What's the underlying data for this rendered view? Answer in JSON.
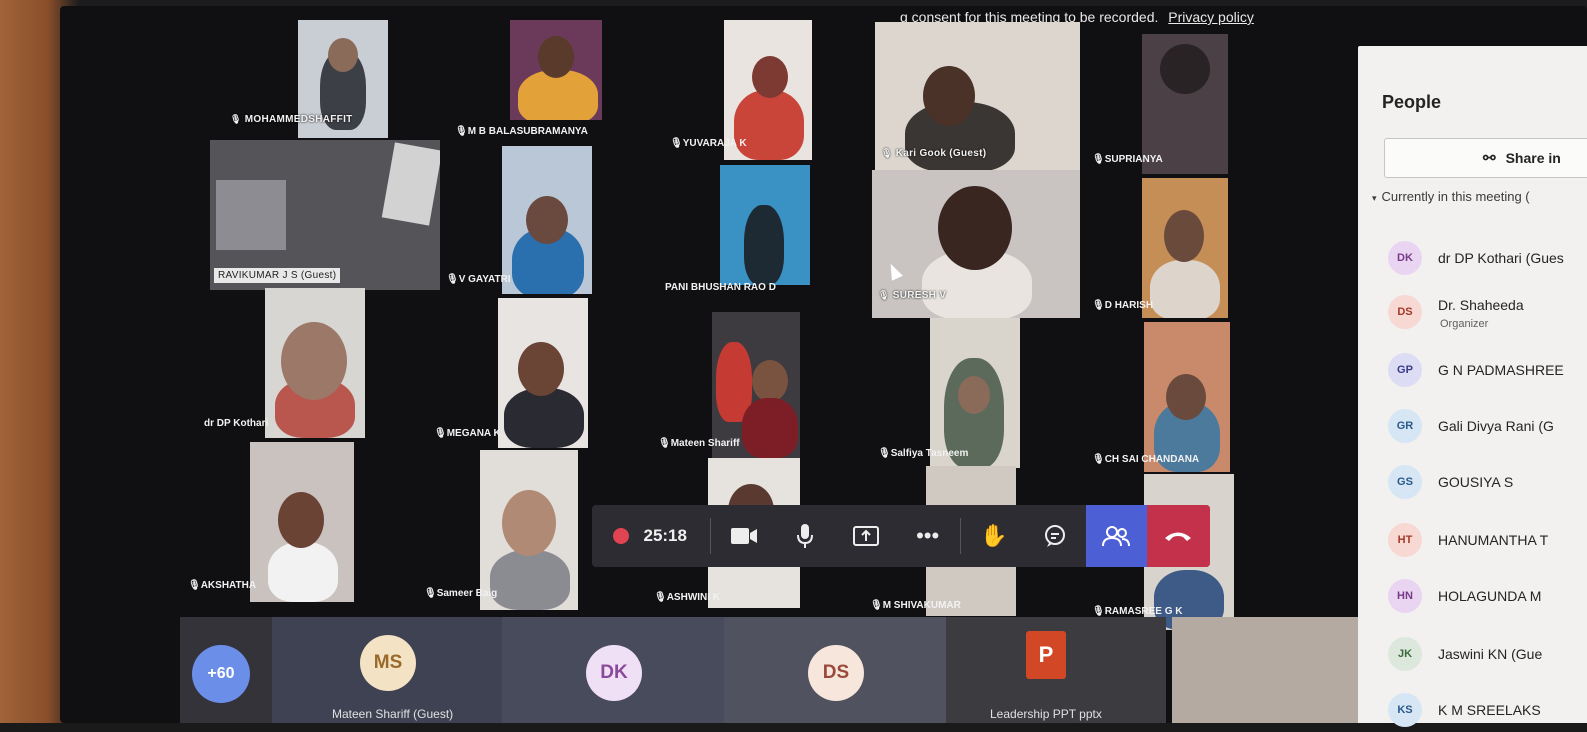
{
  "banner": {
    "text": "g consent for this meeting to be recorded.",
    "link": "Privacy policy"
  },
  "tiles": [
    {
      "name": "MOHAMMEDSHAFFIT"
    },
    {
      "name": "M B BALASUBRAMANYA"
    },
    {
      "name": "YUVARAJA K"
    },
    {
      "name": "Kari Gook (Guest)"
    },
    {
      "name": "SUPRIANYA"
    },
    {
      "name": "RAVIKUMAR J S (Guest)"
    },
    {
      "name": "V GAYATRI"
    },
    {
      "name": "PANI BHUSHAN RAO D"
    },
    {
      "name": "SURESH V"
    },
    {
      "name": "D HARISH"
    },
    {
      "name": "dr DP  Kothari"
    },
    {
      "name": "MEGANA K"
    },
    {
      "name": "Mateen Shariff"
    },
    {
      "name": "Salfiya Tasneem"
    },
    {
      "name": "CH SAI CHANDANA"
    },
    {
      "name": "AKSHATHA"
    },
    {
      "name": "Sameer Baig"
    },
    {
      "name": "ASHWINI K"
    },
    {
      "name": "M SHIVAKUMAR"
    },
    {
      "name": "RAMASREE G K"
    }
  ],
  "toolbar": {
    "timer": "25:18",
    "camera_icon": "camera-icon",
    "mic_icon": "microphone-icon",
    "share_icon": "share-screen-icon",
    "more_icon": "more-icon",
    "hand_icon": "raise-hand-icon",
    "chat_icon": "chat-icon",
    "people_icon": "people-icon",
    "leave_icon": "hang-up-icon",
    "leave_color": "#c4314b",
    "active_color": "#4c5fd4"
  },
  "bottom_row": {
    "more_count": "+60",
    "avatars": [
      {
        "initials": "MS",
        "caption": "Mateen Shariff (Guest)"
      },
      {
        "initials": "DK",
        "caption": ""
      },
      {
        "initials": "DS",
        "caption": ""
      }
    ],
    "file_caption": "Leadership PPT pptx"
  },
  "people_panel": {
    "title": "People",
    "share_label": "Share in",
    "section": "Currently in this meeting (",
    "participants": [
      {
        "initials": "DK",
        "name": "dr DP Kothari (Gues",
        "role": "",
        "color": "#e9d5f2"
      },
      {
        "initials": "DS",
        "name": "Dr. Shaheeda",
        "role": "Organizer",
        "color": "#f7d8d2"
      },
      {
        "initials": "GP",
        "name": "G N PADMASHREE",
        "role": "",
        "color": "#dcdcf5"
      },
      {
        "initials": "GR",
        "name": "Gali Divya Rani (G",
        "role": "",
        "color": "#d6e6f5"
      },
      {
        "initials": "GS",
        "name": "GOUSIYA S",
        "role": "",
        "color": "#d6e6f5"
      },
      {
        "initials": "HT",
        "name": "HANUMANTHA T",
        "role": "",
        "color": "#f7d8d2"
      },
      {
        "initials": "HN",
        "name": "HOLAGUNDA M",
        "role": "",
        "color": "#e9d5f2"
      },
      {
        "initials": "JK",
        "name": "Jaswini KN (Gue",
        "role": "",
        "color": "#dde8dd"
      },
      {
        "initials": "KS",
        "name": "K M SREELAKS",
        "role": "",
        "color": "#d6e6f5"
      }
    ]
  }
}
